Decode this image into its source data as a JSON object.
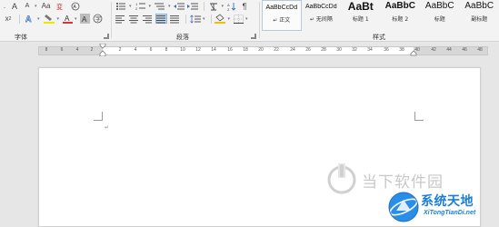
{
  "ribbon": {
    "font_group": {
      "label": "字体",
      "row1": [
        "A",
        "A",
        "Aa",
        "A"
      ],
      "row2": [
        "x",
        "A",
        "A",
        "A"
      ],
      "row2_sup": "2",
      "highlight_label": "ab"
    },
    "paragraph_group": {
      "label": "段落"
    },
    "styles_group": {
      "label": "样式",
      "items": [
        {
          "preview": "AaBbCcDd",
          "name": "正文",
          "prefix": "↵"
        },
        {
          "preview": "AaBbCcDd",
          "name": "无间隔",
          "prefix": "↵"
        },
        {
          "preview": "AaBt",
          "name": "标题 1"
        },
        {
          "preview": "AaBbC",
          "name": "标题 2"
        },
        {
          "preview": "AaBbC",
          "name": "标题"
        },
        {
          "preview": "AaBbC",
          "name": "副标题"
        }
      ]
    }
  },
  "ruler": {
    "left_numbers": [
      "8",
      "6",
      "4",
      "2"
    ],
    "numbers": [
      "2",
      "4",
      "6",
      "8",
      "10",
      "12",
      "14",
      "16",
      "18",
      "20",
      "22",
      "24",
      "26",
      "28",
      "30",
      "32",
      "34",
      "36",
      "38"
    ],
    "right_numbers": [
      "40",
      "42",
      "44",
      "46",
      "48"
    ]
  },
  "document": {
    "paragraph_mark": "↵"
  },
  "watermark_1": {
    "text": "当下软件园"
  },
  "watermark_2": {
    "text": "系统天地",
    "sub": "XiTongTianDi.net"
  },
  "colors": {
    "font_color_red": "#e03030",
    "highlight_yellow": "#f6e300",
    "shading_yellow": "#f0c000",
    "brand_blue": "#1a7ed8"
  }
}
